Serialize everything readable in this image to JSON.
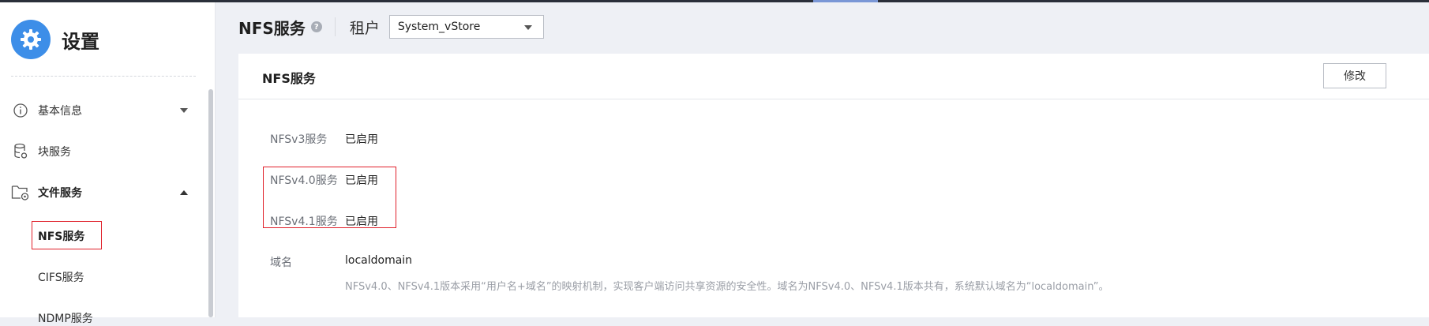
{
  "sidebar": {
    "title": "设置",
    "items": [
      {
        "label": "基本信息",
        "icon": "info-circle-icon",
        "expanded": false
      },
      {
        "label": "块服务",
        "icon": "database-icon"
      },
      {
        "label": "文件服务",
        "icon": "folder-settings-icon",
        "expanded": true
      }
    ],
    "sub_items": [
      {
        "label": "NFS服务",
        "active": true
      },
      {
        "label": "CIFS服务",
        "active": false
      },
      {
        "label": "NDMP服务",
        "active": false
      }
    ]
  },
  "header": {
    "title": "NFS服务",
    "help_icon": "help-icon",
    "help_glyph": "?",
    "tenant_label": "租户",
    "tenant_value": "System_vStore"
  },
  "card": {
    "title": "NFS服务",
    "modify_label": "修改",
    "rows": [
      {
        "key": "NFSv3服务",
        "value": "已启用"
      },
      {
        "key": "NFSv4.0服务",
        "value": "已启用"
      },
      {
        "key": "NFSv4.1服务",
        "value": "已启用"
      },
      {
        "key": "域名",
        "value": "localdomain"
      }
    ],
    "note": "NFSv4.0、NFSv4.1版本采用“用户名+域名”的映射机制，实现客户端访问共享资源的安全性。域名为NFSv4.0、NFSv4.1版本共有，系统默认域名为“localdomain”。"
  },
  "colors": {
    "accent": "#3d8ee8",
    "highlight_border": "#e0202a"
  }
}
